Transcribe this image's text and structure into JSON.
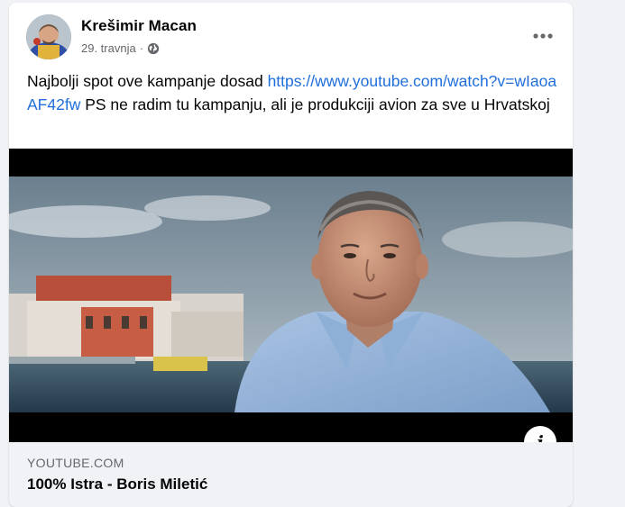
{
  "post": {
    "author": "Krešimir Macan",
    "date": "29. travnja",
    "separator": "·",
    "privacy_icon": "globe-icon",
    "more_icon": "more-horizontal-icon",
    "text_before_link": "Najbolji spot ove kampanje dosad ",
    "link_url": "https://www.youtube.com/watch?v=wIaoaAF42fw",
    "text_after_link": " PS ne radim tu kampanju, ali je produkciji avion za sve u Hrvatskoj"
  },
  "video": {
    "info_label": "i",
    "info_icon": "info-icon"
  },
  "link_preview": {
    "domain": "YOUTUBE.COM",
    "title": "100% Istra - Boris Miletić"
  },
  "colors": {
    "link": "#216fdb",
    "meta_text": "#65676b",
    "card_bg": "#ffffff",
    "page_bg": "#f0f2f5"
  }
}
